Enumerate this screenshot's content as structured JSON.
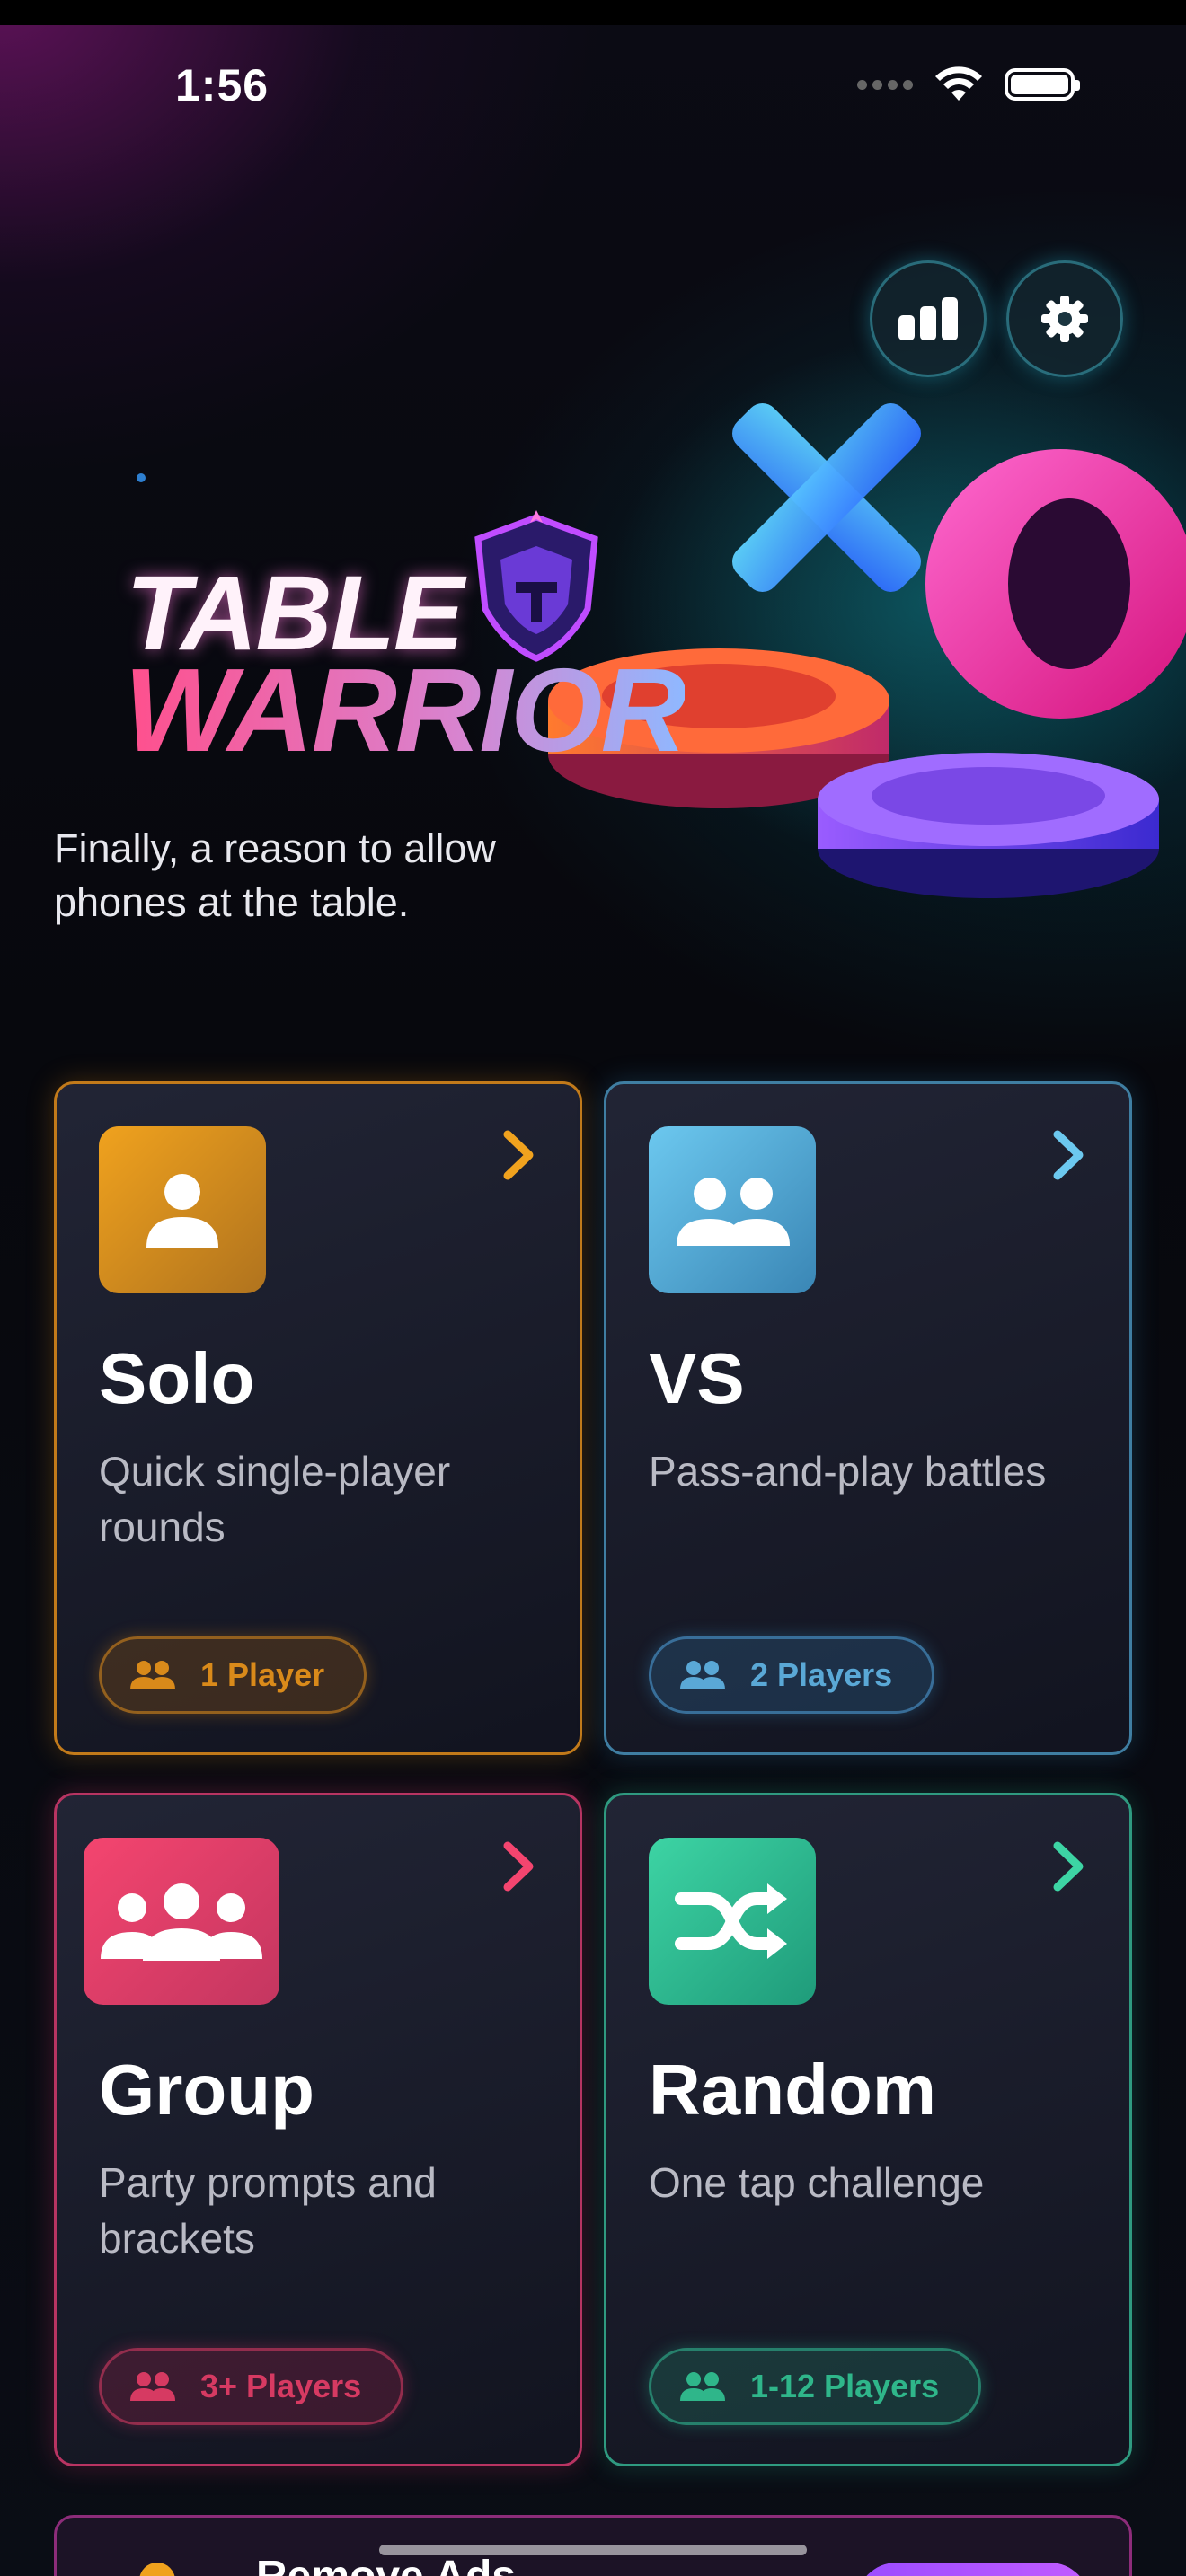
{
  "status_bar": {
    "time": "1:56",
    "battery_level": 1.0
  },
  "header": {
    "stats_icon": "bar-chart-icon",
    "settings_icon": "gear-icon"
  },
  "hero": {
    "logo_line1": "TABLE",
    "logo_line2": "WARRIOR",
    "tagline": "Finally, a reason to allow phones at the table."
  },
  "modes": [
    {
      "title": "Solo",
      "description": "Quick single-player rounds",
      "players": "1 Player",
      "accent": "#F0A21E",
      "icon": "person-icon"
    },
    {
      "title": "VS",
      "description": "Pass-and-play battles",
      "players": "2 Players",
      "accent": "#6CC8EF",
      "icon": "two-people-icon"
    },
    {
      "title": "Group",
      "description": "Party prompts and brackets",
      "players": "3+ Players",
      "accent": "#F4456F",
      "icon": "group-icon"
    },
    {
      "title": "Random",
      "description": "One tap challenge",
      "players": "1-12 Players",
      "accent": "#3DD4A4",
      "icon": "shuffle-icon"
    }
  ],
  "ad_banner": {
    "title": "Remove Ads"
  }
}
